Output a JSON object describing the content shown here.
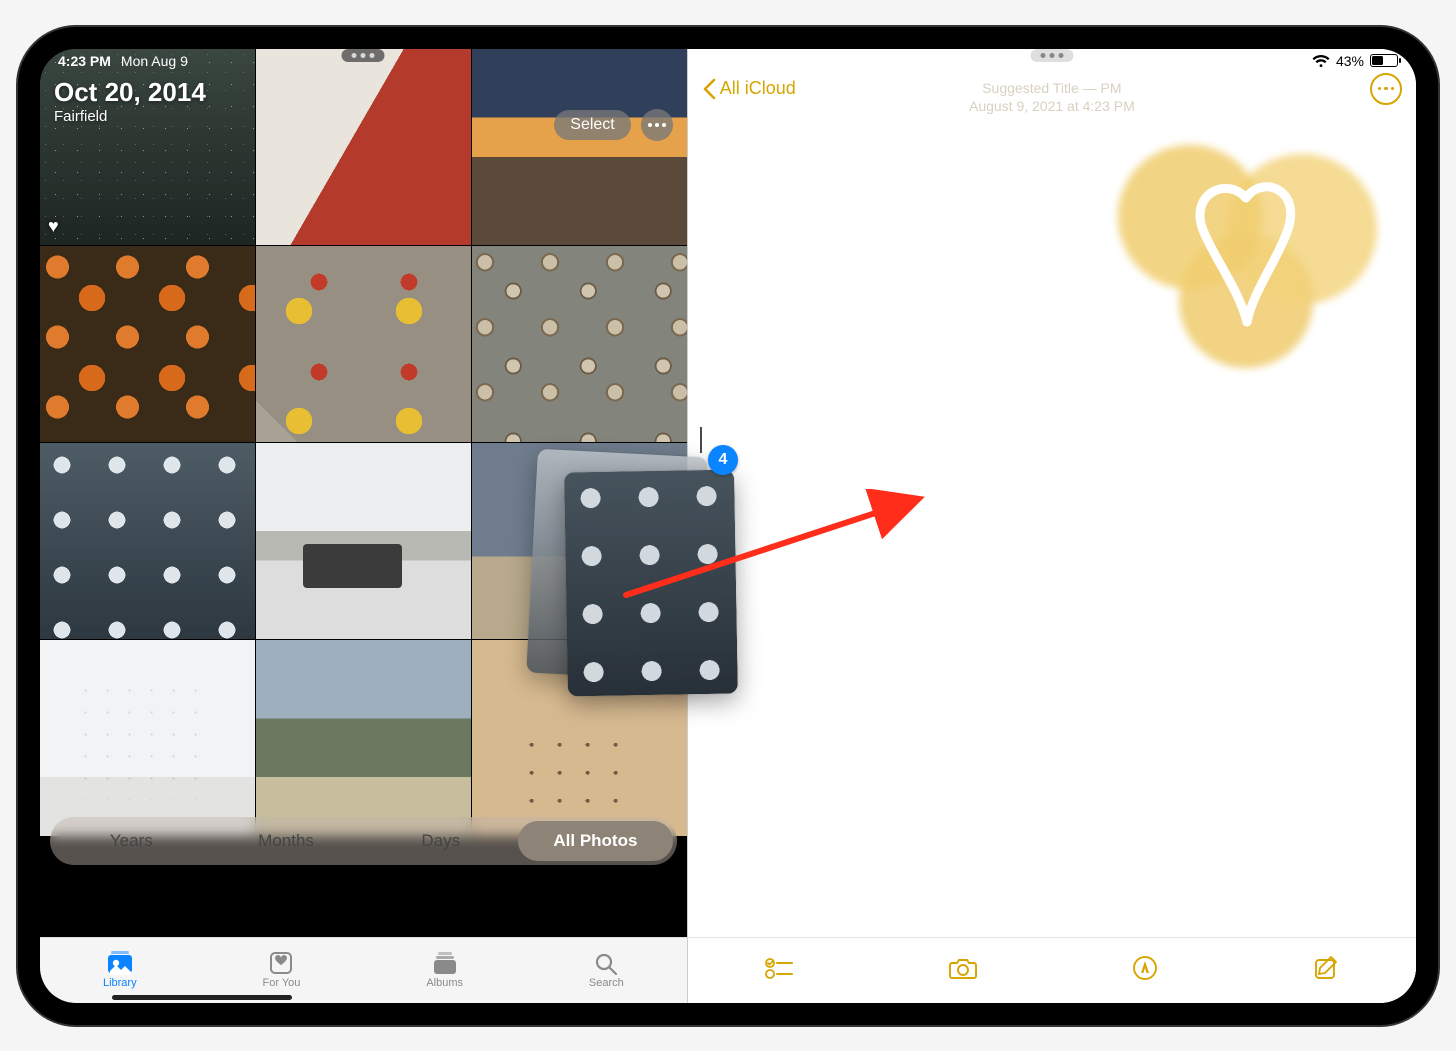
{
  "status": {
    "time": "4:23 PM",
    "date": "Mon Aug 9",
    "battery_pct": "43%"
  },
  "photos": {
    "title": "Oct 20, 2014",
    "location": "Fairfield",
    "select_label": "Select",
    "segments": [
      "Years",
      "Months",
      "Days",
      "All Photos"
    ],
    "active_segment": 3,
    "tabs": [
      "Library",
      "For You",
      "Albums",
      "Search"
    ],
    "active_tab": 0
  },
  "notes": {
    "back_label": "All iCloud",
    "suggested_title": "Suggested Title — PM",
    "suggested_sub": "August 9, 2021 at 4:23 PM",
    "toolbar_icons": [
      "checklist",
      "camera",
      "markup",
      "compose"
    ]
  },
  "drag": {
    "count": "4"
  },
  "icons": {
    "heart_fav": "♥",
    "wifi": "wifi",
    "battery": "battery"
  }
}
